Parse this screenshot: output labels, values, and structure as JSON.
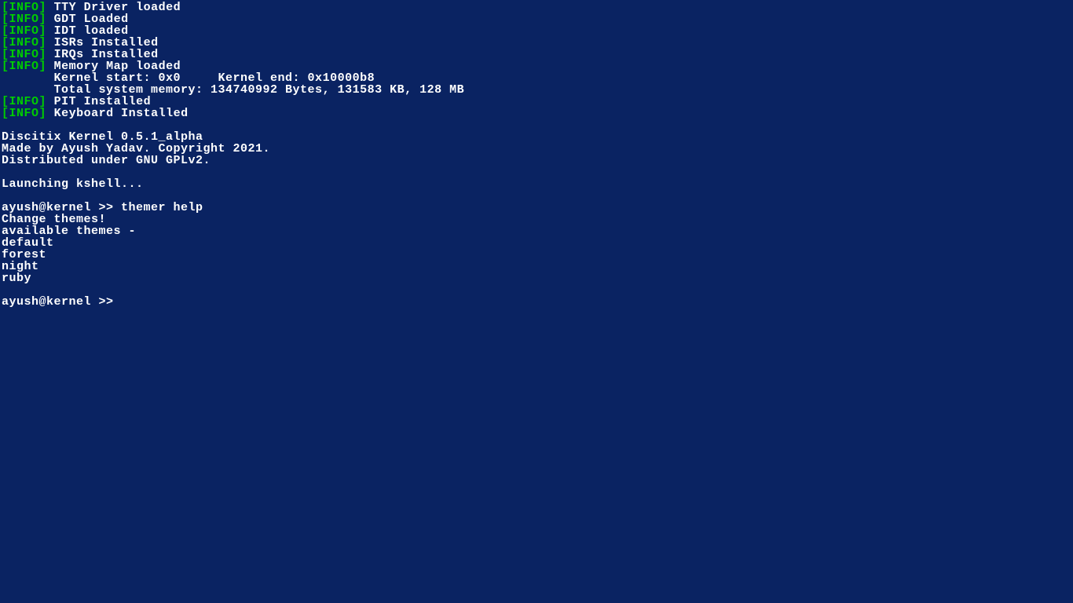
{
  "boot": {
    "tag_open": "[",
    "tag_label": "INFO",
    "tag_close": "]",
    "lines": [
      "TTY Driver loaded",
      "GDT Loaded",
      "IDT loaded",
      "ISRs Installed",
      "IRQs Installed",
      "Memory Map loaded"
    ],
    "memory_detail_1": "       Kernel start: 0x0     Kernel end: 0x10000b8",
    "memory_detail_2": "       Total system memory: 134740992 Bytes, 131583 KB, 128 MB",
    "lines_after": [
      "PIT Installed",
      "Keyboard Installed"
    ]
  },
  "banner": {
    "line1": "Discitix Kernel 0.5.1_alpha",
    "line2": "Made by Ayush Yadav. Copyright 2021.",
    "line3": "Distributed under GNU GPLv2."
  },
  "launching": "Launching kshell...",
  "shell": {
    "prompt": "ayush@kernel >> ",
    "command1": "themer help",
    "output": {
      "title": "Change themes!",
      "avail": "available themes -",
      "themes": [
        "default",
        "forest",
        "night",
        "ruby"
      ]
    },
    "prompt2": "ayush@kernel >> "
  }
}
